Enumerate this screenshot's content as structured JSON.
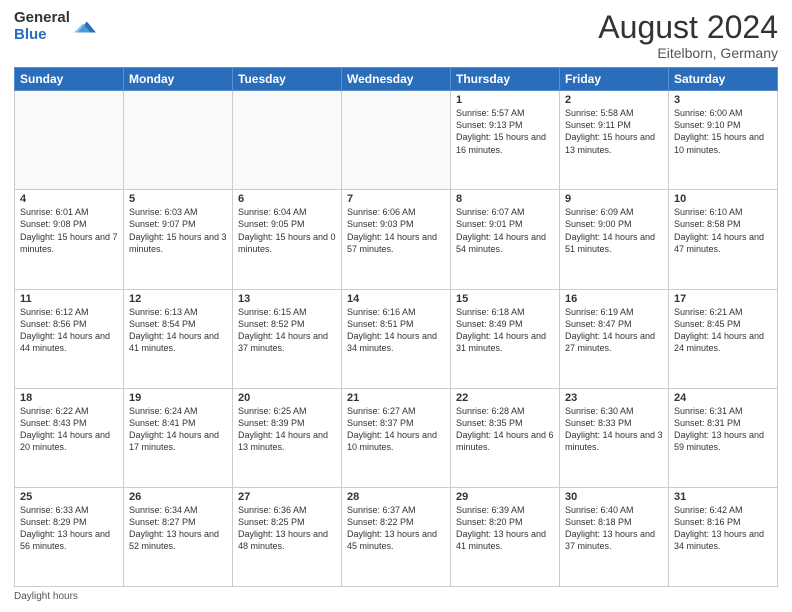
{
  "header": {
    "logo_general": "General",
    "logo_blue": "Blue",
    "month_year": "August 2024",
    "location": "Eitelborn, Germany"
  },
  "weekdays": [
    "Sunday",
    "Monday",
    "Tuesday",
    "Wednesday",
    "Thursday",
    "Friday",
    "Saturday"
  ],
  "weeks": [
    [
      {
        "day": "",
        "info": ""
      },
      {
        "day": "",
        "info": ""
      },
      {
        "day": "",
        "info": ""
      },
      {
        "day": "",
        "info": ""
      },
      {
        "day": "1",
        "info": "Sunrise: 5:57 AM\nSunset: 9:13 PM\nDaylight: 15 hours and 16 minutes."
      },
      {
        "day": "2",
        "info": "Sunrise: 5:58 AM\nSunset: 9:11 PM\nDaylight: 15 hours and 13 minutes."
      },
      {
        "day": "3",
        "info": "Sunrise: 6:00 AM\nSunset: 9:10 PM\nDaylight: 15 hours and 10 minutes."
      }
    ],
    [
      {
        "day": "4",
        "info": "Sunrise: 6:01 AM\nSunset: 9:08 PM\nDaylight: 15 hours and 7 minutes."
      },
      {
        "day": "5",
        "info": "Sunrise: 6:03 AM\nSunset: 9:07 PM\nDaylight: 15 hours and 3 minutes."
      },
      {
        "day": "6",
        "info": "Sunrise: 6:04 AM\nSunset: 9:05 PM\nDaylight: 15 hours and 0 minutes."
      },
      {
        "day": "7",
        "info": "Sunrise: 6:06 AM\nSunset: 9:03 PM\nDaylight: 14 hours and 57 minutes."
      },
      {
        "day": "8",
        "info": "Sunrise: 6:07 AM\nSunset: 9:01 PM\nDaylight: 14 hours and 54 minutes."
      },
      {
        "day": "9",
        "info": "Sunrise: 6:09 AM\nSunset: 9:00 PM\nDaylight: 14 hours and 51 minutes."
      },
      {
        "day": "10",
        "info": "Sunrise: 6:10 AM\nSunset: 8:58 PM\nDaylight: 14 hours and 47 minutes."
      }
    ],
    [
      {
        "day": "11",
        "info": "Sunrise: 6:12 AM\nSunset: 8:56 PM\nDaylight: 14 hours and 44 minutes."
      },
      {
        "day": "12",
        "info": "Sunrise: 6:13 AM\nSunset: 8:54 PM\nDaylight: 14 hours and 41 minutes."
      },
      {
        "day": "13",
        "info": "Sunrise: 6:15 AM\nSunset: 8:52 PM\nDaylight: 14 hours and 37 minutes."
      },
      {
        "day": "14",
        "info": "Sunrise: 6:16 AM\nSunset: 8:51 PM\nDaylight: 14 hours and 34 minutes."
      },
      {
        "day": "15",
        "info": "Sunrise: 6:18 AM\nSunset: 8:49 PM\nDaylight: 14 hours and 31 minutes."
      },
      {
        "day": "16",
        "info": "Sunrise: 6:19 AM\nSunset: 8:47 PM\nDaylight: 14 hours and 27 minutes."
      },
      {
        "day": "17",
        "info": "Sunrise: 6:21 AM\nSunset: 8:45 PM\nDaylight: 14 hours and 24 minutes."
      }
    ],
    [
      {
        "day": "18",
        "info": "Sunrise: 6:22 AM\nSunset: 8:43 PM\nDaylight: 14 hours and 20 minutes."
      },
      {
        "day": "19",
        "info": "Sunrise: 6:24 AM\nSunset: 8:41 PM\nDaylight: 14 hours and 17 minutes."
      },
      {
        "day": "20",
        "info": "Sunrise: 6:25 AM\nSunset: 8:39 PM\nDaylight: 14 hours and 13 minutes."
      },
      {
        "day": "21",
        "info": "Sunrise: 6:27 AM\nSunset: 8:37 PM\nDaylight: 14 hours and 10 minutes."
      },
      {
        "day": "22",
        "info": "Sunrise: 6:28 AM\nSunset: 8:35 PM\nDaylight: 14 hours and 6 minutes."
      },
      {
        "day": "23",
        "info": "Sunrise: 6:30 AM\nSunset: 8:33 PM\nDaylight: 14 hours and 3 minutes."
      },
      {
        "day": "24",
        "info": "Sunrise: 6:31 AM\nSunset: 8:31 PM\nDaylight: 13 hours and 59 minutes."
      }
    ],
    [
      {
        "day": "25",
        "info": "Sunrise: 6:33 AM\nSunset: 8:29 PM\nDaylight: 13 hours and 56 minutes."
      },
      {
        "day": "26",
        "info": "Sunrise: 6:34 AM\nSunset: 8:27 PM\nDaylight: 13 hours and 52 minutes."
      },
      {
        "day": "27",
        "info": "Sunrise: 6:36 AM\nSunset: 8:25 PM\nDaylight: 13 hours and 48 minutes."
      },
      {
        "day": "28",
        "info": "Sunrise: 6:37 AM\nSunset: 8:22 PM\nDaylight: 13 hours and 45 minutes."
      },
      {
        "day": "29",
        "info": "Sunrise: 6:39 AM\nSunset: 8:20 PM\nDaylight: 13 hours and 41 minutes."
      },
      {
        "day": "30",
        "info": "Sunrise: 6:40 AM\nSunset: 8:18 PM\nDaylight: 13 hours and 37 minutes."
      },
      {
        "day": "31",
        "info": "Sunrise: 6:42 AM\nSunset: 8:16 PM\nDaylight: 13 hours and 34 minutes."
      }
    ]
  ],
  "footer": {
    "note": "Daylight hours"
  }
}
